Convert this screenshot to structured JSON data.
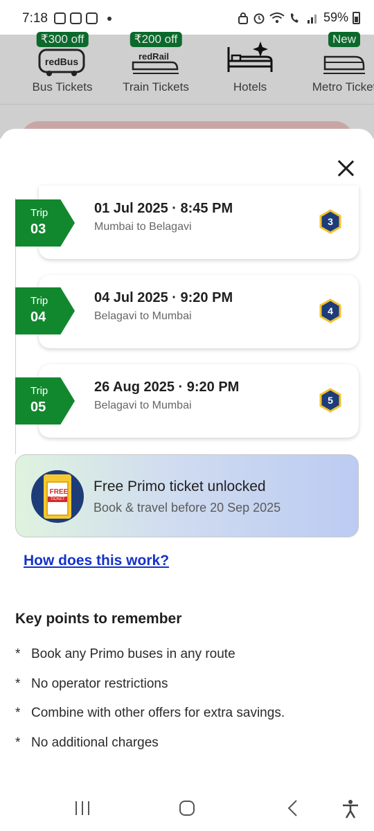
{
  "status_bar": {
    "time": "7:18",
    "battery": "59%"
  },
  "background": {
    "categories": [
      {
        "label": "Bus Tickets",
        "badge": "₹300 off",
        "logo_text": "redBus",
        "icon": "bus-icon"
      },
      {
        "label": "Train Tickets",
        "badge": "₹200 off",
        "logo_text": "redRail",
        "icon": "train-icon"
      },
      {
        "label": "Hotels",
        "badge": "",
        "icon": "bed-icon"
      },
      {
        "label": "Metro Ticket",
        "badge": "New",
        "icon": "metro-icon"
      }
    ]
  },
  "sheet": {
    "trips": [
      {
        "tag_label": "Trip",
        "tag_number": "03",
        "datetime": "01 Jul 2025 · 8:45 PM",
        "route": "Mumbai to Belagavi",
        "badge": "3"
      },
      {
        "tag_label": "Trip",
        "tag_number": "04",
        "datetime": "04 Jul 2025 · 9:20 PM",
        "route": "Belagavi to Mumbai",
        "badge": "4"
      },
      {
        "tag_label": "Trip",
        "tag_number": "05",
        "datetime": "26 Aug 2025 · 9:20 PM",
        "route": "Belagavi to Mumbai",
        "badge": "5"
      }
    ],
    "promo": {
      "title": "Free Primo ticket unlocked",
      "subtitle": "Book & travel before 20 Sep 2025",
      "ticket_text": "FREE",
      "ticket_sub": "TICKET"
    },
    "how_link": "How does this work?",
    "key_points": {
      "title": "Key points to remember",
      "bullet": "*",
      "items": [
        "Book any Primo buses in any route",
        "No operator restrictions",
        "Combine with other offers for extra savings.",
        "No additional charges"
      ]
    }
  },
  "colors": {
    "trip_tag": "#12882e",
    "hex_badge_fill": "#1e3c78",
    "hex_badge_border": "#f2c230",
    "link": "#1432c8"
  }
}
